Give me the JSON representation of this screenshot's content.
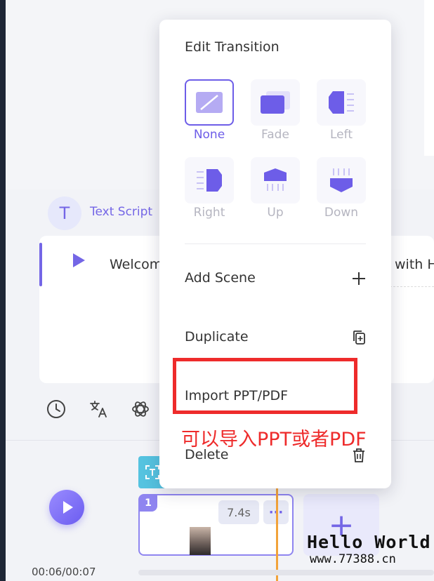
{
  "script": {
    "tab_label": "Text Script",
    "avatar_letter": "T",
    "text_left": "Welcom",
    "text_right": "with H"
  },
  "timeline": {
    "time": "00:06/00:07",
    "scene_number": "1",
    "scene_duration": "7.4s",
    "more": "···",
    "tag_icon": "text-frame-icon"
  },
  "menu": {
    "title": "Edit Transition",
    "transitions": [
      {
        "label": "None",
        "icon": "none-transition-icon",
        "selected": true
      },
      {
        "label": "Fade",
        "icon": "fade-transition-icon",
        "selected": false
      },
      {
        "label": "Left",
        "icon": "left-transition-icon",
        "selected": false
      },
      {
        "label": "Right",
        "icon": "right-transition-icon",
        "selected": false
      },
      {
        "label": "Up",
        "icon": "up-transition-icon",
        "selected": false
      },
      {
        "label": "Down",
        "icon": "down-transition-icon",
        "selected": false
      }
    ],
    "items": [
      {
        "label": "Add Scene",
        "icon": "plus-icon"
      },
      {
        "label": "Duplicate",
        "icon": "duplicate-icon"
      },
      {
        "label": "Import PPT/PDF",
        "icon": ""
      },
      {
        "label": "Delete",
        "icon": "trash-icon"
      }
    ]
  },
  "annotation": "可以导入PPT或者PDF",
  "watermark": {
    "title": "Hello World",
    "url": "www.77388.cn"
  },
  "colors": {
    "accent": "#6d5de8",
    "annotation_red": "#ee2b2b",
    "playhead": "#f2a33a"
  }
}
